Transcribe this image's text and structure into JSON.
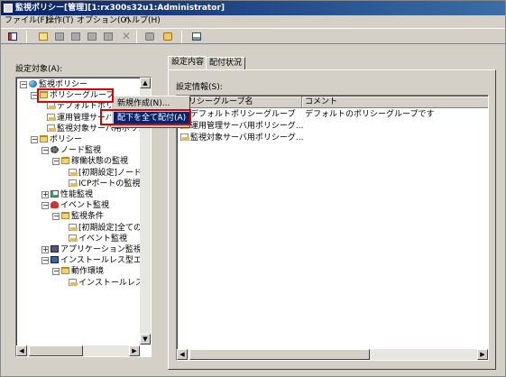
{
  "window": {
    "title": "監視ポリシー[管理][1:rx300s32u1:Administrator]"
  },
  "menu": [
    {
      "label": "ファイル(F)"
    },
    {
      "label": "操作(T)"
    },
    {
      "label": "オプション(O)"
    },
    {
      "label": "ヘルプ(H)"
    }
  ],
  "toolbar": {
    "buttons": [
      "properties-icon",
      "new-icon",
      "copy-icon",
      "edit-icon",
      "paste-icon",
      "delete-icon",
      "cross-icon",
      "upload-icon",
      "distribute-icon",
      "refresh-icon"
    ]
  },
  "left": {
    "label": "設定対象(A):"
  },
  "tree": [
    {
      "label": "監視ポリシー",
      "icon": "globe-icon",
      "indent": 0,
      "toggle": "−"
    },
    {
      "label": "ポリシーグループ",
      "icon": "folder-icon",
      "indent": 1,
      "toggle": "−"
    },
    {
      "label": "デフォルトポリシーグループ",
      "icon": "doc-icon",
      "indent": 2,
      "toggle": ""
    },
    {
      "label": "運用管理サーバ用ポリシーグループ",
      "icon": "doc-icon",
      "indent": 2,
      "toggle": ""
    },
    {
      "label": "監視対象サーバ用ポリシーグループ",
      "icon": "doc-icon",
      "indent": 2,
      "toggle": ""
    },
    {
      "label": "ポリシー",
      "icon": "folder-icon",
      "indent": 1,
      "toggle": "−"
    },
    {
      "label": "ノード監視",
      "icon": "gear-icon",
      "indent": 2,
      "toggle": "−"
    },
    {
      "label": "稼働状態の監視",
      "icon": "folder-icon",
      "indent": 3,
      "toggle": "−"
    },
    {
      "label": "[初期設定]ノード監視",
      "icon": "doc-icon",
      "indent": 4,
      "toggle": ""
    },
    {
      "label": "ICPポートの監視",
      "icon": "doc-icon",
      "indent": 4,
      "toggle": ""
    },
    {
      "label": "性能監視",
      "icon": "chart-icon",
      "indent": 2,
      "toggle": "+"
    },
    {
      "label": "イベント監視",
      "icon": "bell-icon",
      "indent": 2,
      "toggle": "−"
    },
    {
      "label": "監視条件",
      "icon": "folder-icon",
      "indent": 3,
      "toggle": "−"
    },
    {
      "label": "[初期設定]全てのイベント",
      "icon": "doc-icon",
      "indent": 4,
      "toggle": ""
    },
    {
      "label": "イベント監視",
      "icon": "doc-icon",
      "indent": 4,
      "toggle": ""
    },
    {
      "label": "アプリケーション監視",
      "icon": "app-icon",
      "indent": 2,
      "toggle": "+"
    },
    {
      "label": "インストールレス型エージェント監視",
      "icon": "inst-icon",
      "indent": 2,
      "toggle": "−"
    },
    {
      "label": "動作環境",
      "icon": "folder-icon",
      "indent": 3,
      "toggle": "−"
    },
    {
      "label": "インストールレス",
      "icon": "doc-icon",
      "indent": 4,
      "toggle": ""
    }
  ],
  "context_menu": {
    "items": [
      {
        "label": "新規作成(N)..."
      },
      {
        "label": "配下を全て配付(A)"
      }
    ]
  },
  "tabs": [
    {
      "label": "設定内容"
    },
    {
      "label": "配付状況"
    }
  ],
  "details": {
    "label": "設定情報(S):",
    "columns": [
      "ポリシーグループ名",
      "コメント"
    ],
    "rows": [
      {
        "name": "デフォルトポリシーグループ",
        "comment": "デフォルトのポリシーグループです"
      },
      {
        "name": "運用管理サーバ用ポリシーグ...",
        "comment": ""
      },
      {
        "name": "監視対象サーバ用ポリシーグ...",
        "comment": ""
      }
    ]
  }
}
